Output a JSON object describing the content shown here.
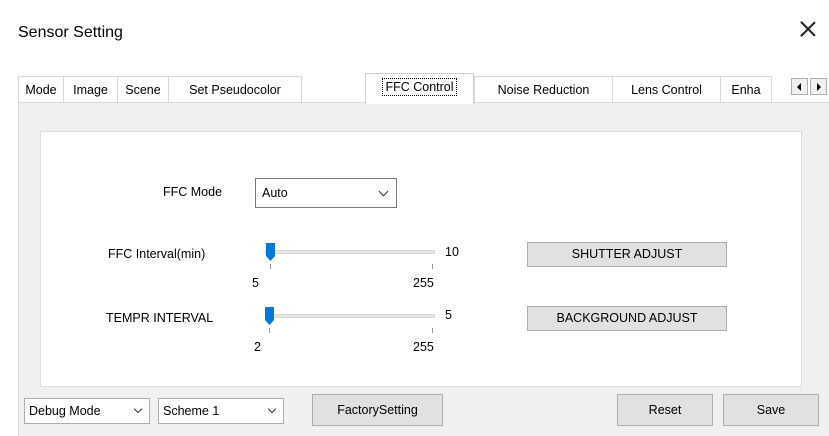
{
  "window": {
    "title": "Sensor Setting"
  },
  "tabs": [
    {
      "label": "Mode",
      "active": false
    },
    {
      "label": "Image",
      "active": false
    },
    {
      "label": "Scene",
      "active": false
    },
    {
      "label": "Set Pseudocolor",
      "active": false
    },
    {
      "label": "FFC Control",
      "active": true
    },
    {
      "label": "Noise Reduction",
      "active": false
    },
    {
      "label": "Lens Control",
      "active": false
    },
    {
      "label": "Enha",
      "active": false
    }
  ],
  "ffc": {
    "mode_label": "FFC Mode",
    "mode_value": "Auto",
    "interval": {
      "label": "FFC Interval(min)",
      "value": "10",
      "min": "5",
      "max": "255"
    },
    "tempr": {
      "label": "TEMPR INTERVAL",
      "value": "5",
      "min": "2",
      "max": "255"
    },
    "shutter_button": "SHUTTER ADJUST",
    "background_button": "BACKGROUND ADJUST"
  },
  "footer": {
    "debug_mode": "Debug Mode",
    "scheme": "Scheme 1",
    "factory_button": "FactorySetting",
    "reset_button": "Reset",
    "save_button": "Save"
  },
  "icons": {
    "close": "close-icon",
    "tab_left": "arrow-left-icon",
    "tab_right": "arrow-right-icon",
    "dropdown": "chevron-down-icon"
  },
  "colors": {
    "panel_bg": "#f0f0f0",
    "button_bg": "#e1e1e1",
    "thumb": "#0078d7"
  }
}
